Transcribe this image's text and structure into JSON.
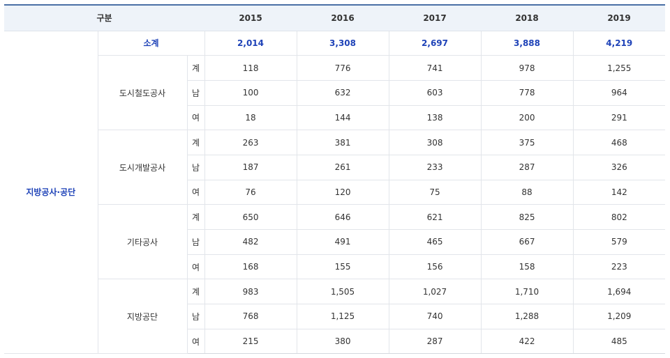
{
  "header": {
    "category_label": "구분",
    "years": [
      "2015",
      "2016",
      "2017",
      "2018",
      "2019"
    ]
  },
  "group_label": "지방공사·공단",
  "subtotal": {
    "label": "소계",
    "values": [
      "2,014",
      "3,308",
      "2,697",
      "3,888",
      "4,219"
    ]
  },
  "categories": [
    {
      "name": "도시철도공사",
      "rows": [
        {
          "type": "계",
          "values": [
            "118",
            "776",
            "741",
            "978",
            "1,255"
          ]
        },
        {
          "type": "남",
          "values": [
            "100",
            "632",
            "603",
            "778",
            "964"
          ]
        },
        {
          "type": "여",
          "values": [
            "18",
            "144",
            "138",
            "200",
            "291"
          ]
        }
      ]
    },
    {
      "name": "도시개발공사",
      "rows": [
        {
          "type": "계",
          "values": [
            "263",
            "381",
            "308",
            "375",
            "468"
          ]
        },
        {
          "type": "남",
          "values": [
            "187",
            "261",
            "233",
            "287",
            "326"
          ]
        },
        {
          "type": "여",
          "values": [
            "76",
            "120",
            "75",
            "88",
            "142"
          ]
        }
      ]
    },
    {
      "name": "기타공사",
      "rows": [
        {
          "type": "계",
          "values": [
            "650",
            "646",
            "621",
            "825",
            "802"
          ]
        },
        {
          "type": "남",
          "values": [
            "482",
            "491",
            "465",
            "667",
            "579"
          ]
        },
        {
          "type": "여",
          "values": [
            "168",
            "155",
            "156",
            "158",
            "223"
          ]
        }
      ]
    },
    {
      "name": "지방공단",
      "rows": [
        {
          "type": "계",
          "values": [
            "983",
            "1,505",
            "1,027",
            "1,710",
            "1,694"
          ]
        },
        {
          "type": "남",
          "values": [
            "768",
            "1,125",
            "740",
            "1,288",
            "1,209"
          ]
        },
        {
          "type": "여",
          "values": [
            "215",
            "380",
            "287",
            "422",
            "485"
          ]
        }
      ]
    }
  ]
}
